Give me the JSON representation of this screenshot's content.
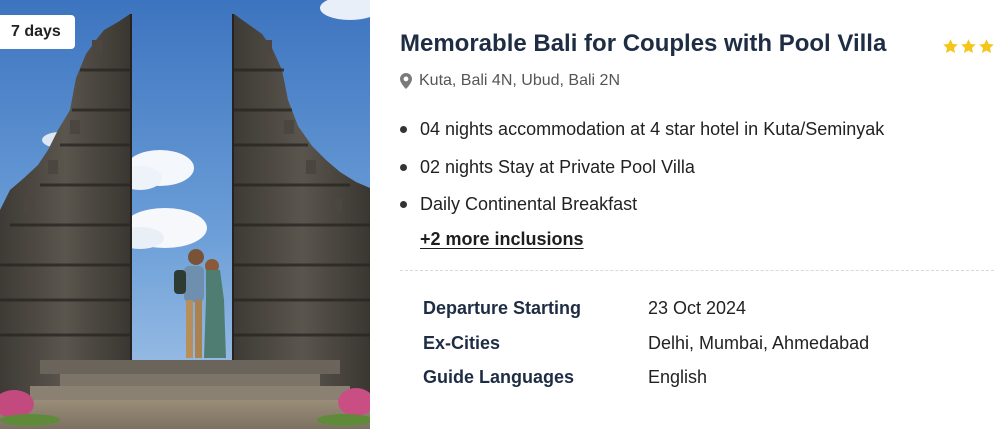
{
  "package": {
    "duration_badge": "7 days",
    "title": "Memorable Bali for Couples with Pool Villa",
    "star_rating": 3,
    "star_color": "#f5c518",
    "location_icon": "map-pin-icon",
    "location": "Kuta, Bali 4N, Ubud, Bali 2N",
    "inclusions": [
      "04 nights accommodation at 4 star hotel in Kuta/Seminyak",
      "02 nights Stay at Private Pool Villa",
      "Daily Continental Breakfast"
    ],
    "more_inclusions_link": "+2 more inclusions",
    "details": [
      {
        "label": "Departure Starting",
        "value": "23 Oct 2024"
      },
      {
        "label": "Ex-Cities",
        "value": "Delhi, Mumbai, Ahmedabad"
      },
      {
        "label": "Guide Languages",
        "value": "English"
      }
    ]
  },
  "colors": {
    "title": "#1f2d44",
    "text": "#222222",
    "muted": "#555555",
    "divider": "#d9d9d9"
  }
}
